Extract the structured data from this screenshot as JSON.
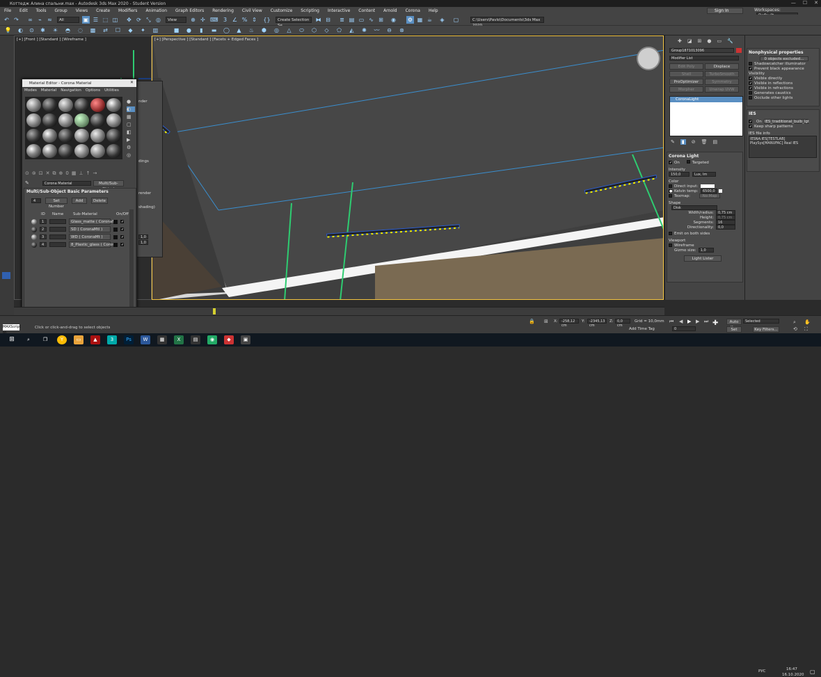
{
  "window": {
    "title": "Коттедж Алина спальни.max - Autodesk 3ds Max 2020 - Student Version",
    "min": "—",
    "max": "☐",
    "close": "✕"
  },
  "menu": [
    "File",
    "Edit",
    "Tools",
    "Group",
    "Views",
    "Create",
    "Modifiers",
    "Animation",
    "Graph Editors",
    "Rendering",
    "Civil View",
    "Customize",
    "Scripting",
    "Interactive",
    "Content",
    "Arnold",
    "Corona",
    "Help"
  ],
  "account": {
    "signin": "Sign In",
    "workspaces_label": "Workspaces:",
    "workspace_value": "Default"
  },
  "toolbar": {
    "filter_value": "All",
    "refcoord_value": "View",
    "selection_set_placeholder": "Create Selection Se",
    "project_path": "C:\\Users\\Pavlo\\Documents\\3ds Max 2020"
  },
  "viewports": {
    "left_label": "[+] [Front ] [Standard ] [Wireframe ]",
    "persp_label": "[+] [Perspective ] [Standard ] [Facets + Edged Faces ]"
  },
  "material_editor": {
    "title": "Material Editor - Corona Material",
    "menu": [
      "Modes",
      "Material",
      "Navigation",
      "Options",
      "Utilities"
    ],
    "material_name": "Corona Material",
    "material_type": "Multi/Sub-Object",
    "rollout_title": "Multi/Sub-Object Basic Parameters",
    "count": "4",
    "set_number": "Set Number",
    "add": "Add",
    "delete": "Delete",
    "columns": [
      "ID",
      "Name",
      "Sub-Material",
      "On/Off"
    ],
    "rows": [
      {
        "id": "1",
        "sub": "Glass_matte ( CoronaM"
      },
      {
        "id": "2",
        "sub": "SD ( CoronaMtl )"
      },
      {
        "id": "3",
        "sub": "WD ( CoronaMt )"
      },
      {
        "id": "4",
        "sub": "8_Plastic_glass ( Corona"
      }
    ]
  },
  "bg_window": {
    "a": "nder",
    "b": "dings",
    "c": "render",
    "d": "shading)",
    "v1": "1,0",
    "v2": "1,0"
  },
  "command_panel": {
    "object_name": "Group1871013096",
    "modifier_list": "Modifier List",
    "mod_buttons": [
      "Edit Poly",
      "Displace",
      "Shell",
      "TurboSmooth",
      "ProOptimizer",
      "Symmetry",
      "Morpher",
      "Unwrap UVW"
    ],
    "stack_item": "CoronaLight",
    "rollout_title": "Corona Light",
    "on": "On",
    "targeted": "Targeted",
    "intensity_label": "Intensity",
    "intensity_value": "150,0",
    "intensity_unit": "Lux, lm",
    "color_label": "Color",
    "direct_input": "Direct input:",
    "kelvin": "Kelvin temp:",
    "kelvin_value": "6500,0",
    "texmap": "Texmap:",
    "no_map": "No Map",
    "shape_label": "Shape",
    "shape_value": "Disk",
    "width_label": "Width/radius:",
    "width_value": "0,75 cm",
    "height_label": "Height:",
    "height_value": "0,75 cm",
    "segments_label": "Segments:",
    "segments_value": "16",
    "direct_label": "Directionality:",
    "direct_value": "0,0",
    "emit_both": "Emit on both sides",
    "viewport_label": "Viewport",
    "wireframe": "Wireframe",
    "gizmo_label": "Gizmo size:",
    "gizmo_value": "1,0",
    "light_lister": "Light Lister"
  },
  "props_panel": {
    "title": "Nonphysical properties",
    "excluded": "0 objects excluded...",
    "shadowcatcher": "Shadowcatcher illuminator",
    "prevent": "Prevent black appearance",
    "visibility": "Visibility",
    "vis_items": [
      "Visible directly",
      "Visible in reflections",
      "Visible in refractions",
      "Generates caustics",
      "Occlude other lights"
    ],
    "ies_title": "IES",
    "ies_on": "On",
    "ies_file": "IES_traditional_bulb_lgt",
    "keep_sharp": "Keep sharp patterns",
    "ies_info_label": "IES file info",
    "ies_info": "IESNA:IES[TESTLAB] PlaySys[MANUFAC] Real IES"
  },
  "status": {
    "prompt": "Click or click-and-drag to select objects",
    "x_label": "X:",
    "x_value": "-258,12 cm",
    "y_label": "Y:",
    "y_value": "-2345,13 cm",
    "z_label": "Z:",
    "z_value": "0,0 cm",
    "grid": "Grid = 10,0mm",
    "add_time_tag": "Add Time Tag",
    "auto_key": "Auto Key",
    "set_key": "Set Key",
    "selected": "Selected",
    "key_filters": "Key Filters...",
    "frame": "0",
    "maxscript": "MAXScript Mi"
  },
  "taskbar": {
    "lang": "РУС",
    "time": "16:47",
    "date": "16.10.2020"
  },
  "colors": {
    "accent": "#5a8fc2",
    "viewport_border": "#f4c542",
    "light_yellow": "#f4f000",
    "selection_blue": "#2f5fd0",
    "green_line": "#2ecc71"
  }
}
